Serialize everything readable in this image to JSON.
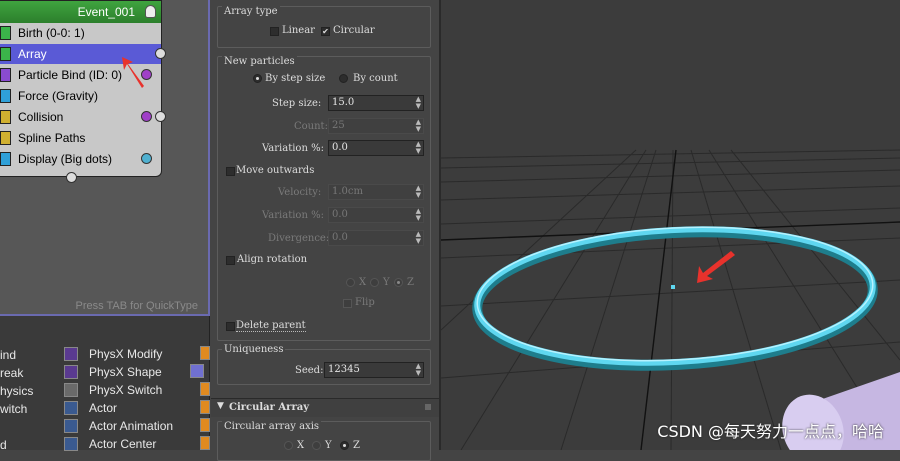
{
  "event": {
    "title": "Event_001",
    "operators": [
      {
        "label": "Birth (0-0: 1)",
        "icon": "birth-icon",
        "color": "#3bb44a"
      },
      {
        "label": "Array",
        "icon": "array-icon",
        "color": "#3bb44a",
        "selected": true
      },
      {
        "label": "Particle Bind (ID: 0)",
        "icon": "particle-bind-icon",
        "color": "#8a4bd0"
      },
      {
        "label": "Force (Gravity)",
        "icon": "force-icon",
        "color": "#2fa0d8"
      },
      {
        "label": "Collision",
        "icon": "collision-icon",
        "color": "#d0b030"
      },
      {
        "label": "Spline Paths",
        "icon": "spline-paths-icon",
        "color": "#d0b030"
      },
      {
        "label": "Display (Big dots)",
        "icon": "display-icon",
        "color": "#2fa0d8"
      }
    ],
    "quicktype_hint": "Press TAB for QuickType"
  },
  "depot": {
    "left_column": [
      "ind",
      "reak",
      "hysics",
      "witch",
      "d"
    ],
    "right_column": [
      {
        "label": "PhysX Modify",
        "icon": "physx-modify-icon"
      },
      {
        "label": "PhysX Shape",
        "icon": "physx-shape-icon"
      },
      {
        "label": "PhysX Switch",
        "icon": "physx-switch-icon"
      },
      {
        "label": "Actor",
        "icon": "actor-icon"
      },
      {
        "label": "Actor Animation",
        "icon": "actor-animation-icon"
      },
      {
        "label": "Actor Center",
        "icon": "actor-center-icon"
      }
    ]
  },
  "params": {
    "array_type": {
      "title": "Array type",
      "linear": "Linear",
      "circular": "Circular",
      "linear_checked": false,
      "circular_checked": true
    },
    "new_particles": {
      "title": "New particles",
      "by_step_size": "By step size",
      "by_count": "By count",
      "step_size_label": "Step size:",
      "step_size_value": "15.0",
      "count_label": "Count:",
      "count_value": "25",
      "variation_label": "Variation %:",
      "variation_value": "0.0",
      "move_outwards": "Move outwards",
      "velocity_label": "Velocity:",
      "velocity_value": "1.0cm",
      "variation2_label": "Variation %:",
      "variation2_value": "0.0",
      "divergence_label": "Divergence:",
      "divergence_value": "0.0",
      "align_rotation": "Align rotation",
      "axis_x": "X",
      "axis_y": "Y",
      "axis_z": "Z",
      "flip": "Flip",
      "delete_parent": "Delete parent"
    },
    "uniqueness": {
      "title": "Uniqueness",
      "seed_label": "Seed:",
      "seed_value": "12345"
    },
    "circular_array": {
      "title": "Circular Array",
      "axis_title": "Circular array axis",
      "axis_x": "X",
      "axis_y": "Y",
      "axis_z": "Z"
    }
  },
  "watermark": "CSDN @每天努力一点点，哈哈",
  "colors": {
    "ring": "#5fd7f0",
    "selected_row": "#5a5ad6",
    "event_header": "#3a9a3a",
    "arrow": "#e8322c"
  }
}
